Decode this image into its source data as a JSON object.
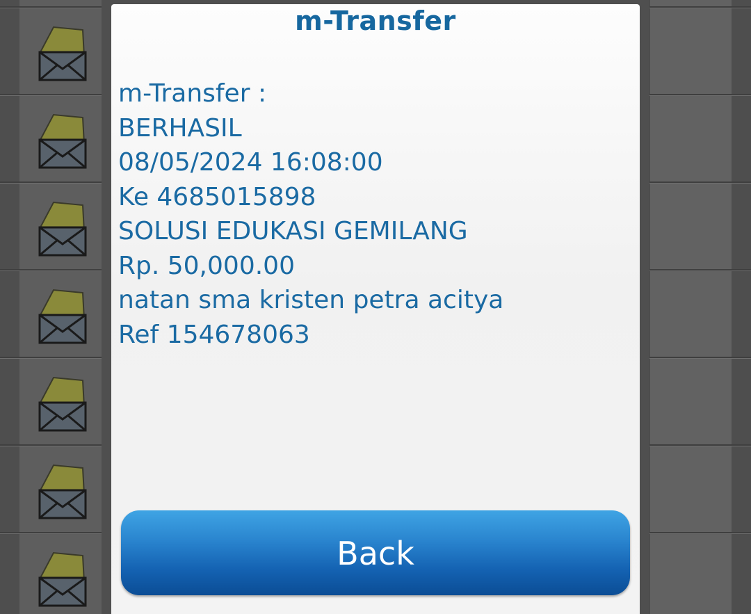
{
  "dialog": {
    "title": "m-Transfer",
    "message_lines": [
      "m-Transfer :",
      "BERHASIL",
      "08/05/2024 16:08:00",
      "Ke 4685015898",
      "SOLUSI EDUKASI GEMILANG",
      "Rp. 50,000.00",
      "natan sma kristen petra acitya",
      "Ref 154678063"
    ],
    "back_label": "Back"
  },
  "icons": {
    "inbox_message": "envelope-open-icon"
  },
  "colors": {
    "title_text": "#16679f",
    "message_text": "#1a6aa3",
    "button_top": "#3fa4e4",
    "button_bottom": "#0b4d95",
    "button_text": "#ffffff",
    "dialog_bg": "#f3f3f3",
    "overlay_bg": "#5c5c5c"
  }
}
